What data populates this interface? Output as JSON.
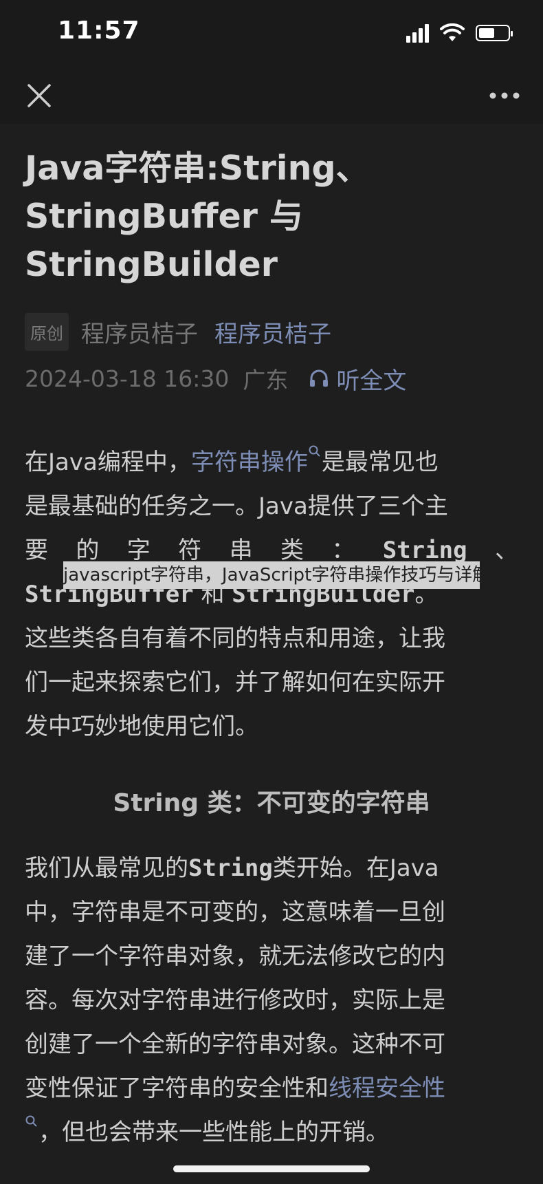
{
  "status_bar": {
    "time": "11:57",
    "icons": [
      "signal-icon",
      "wifi-icon",
      "battery-icon"
    ]
  },
  "nav_bar": {
    "close_icon": "close-icon",
    "more_icon": "more-icon"
  },
  "article": {
    "title_lines": [
      "Java字符串:String、",
      "StringBuffer 与",
      "StringBuilder"
    ],
    "badge": "原创",
    "author_name": "程序员桔子",
    "author_link": "程序员桔子",
    "date": "2024-03-18 16:30",
    "location": "广东",
    "listen_label": "听全文",
    "p1": {
      "r1_a": "在Java编程中，",
      "r1_link": "字符串操作",
      "r1_b": "是最常见也",
      "r2": "是最基础的任务之一。Java提供了三个主",
      "r3_a": "要",
      "r3_b": "的",
      "r3_c": "字",
      "r3_d": "符",
      "r3_e": "串",
      "r3_f": "类",
      "r3_g": "：",
      "r3_h": "String",
      "r3_i": "、",
      "r4_a": "StringBuffer",
      "r4_b": " 和 ",
      "r4_c": "StringBuilder",
      "r4_d": "。",
      "r5": "这些类各自有着不同的特点和用途，让我",
      "r6": "们一起来探索它们，并了解如何在实际开",
      "r7": "发中巧妙地使用它们。"
    },
    "subheading": "String 类：不可变的字符串",
    "p2": {
      "r1_a": "我们从最常见的",
      "r1_mono": "String",
      "r1_b": "类开始。在Java",
      "r2": "中，字符串是不可变的，这意味着一旦创",
      "r3": "建了一个字符串对象，就无法修改它的内",
      "r4": "容。每次对字符串进行修改时，实际上是",
      "r5": "创建了一个全新的字符串对象。这种不可",
      "r6_a": "变性保证了字符串的安全性和",
      "r6_link": "线程安全性",
      "r7": "，但也会带来一些性能上的开销。"
    }
  },
  "overlay_caption": "javascript字符串，JavaScript字符串操作技巧与详解",
  "colors": {
    "background": "#1e1e1e",
    "text": "#cfcfcf",
    "link": "#7d8db5",
    "muted": "#6c6c6c"
  }
}
